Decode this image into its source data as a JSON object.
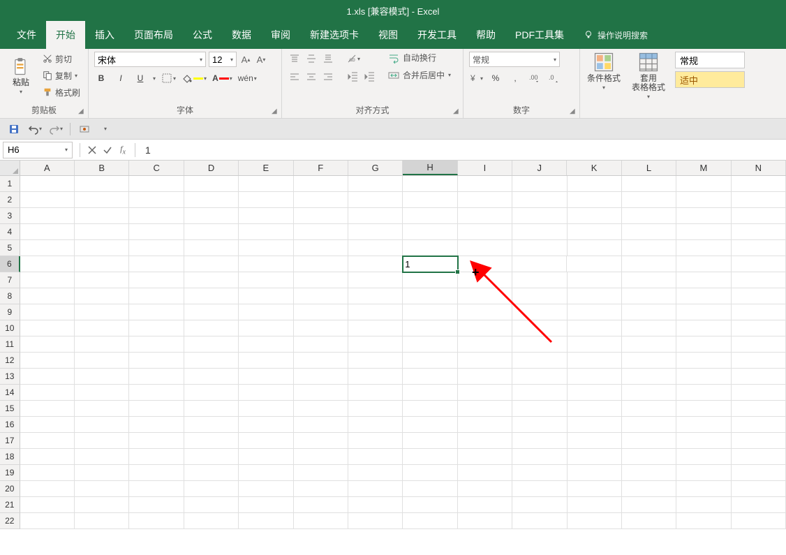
{
  "title": "1.xls  [兼容模式]  -  Excel",
  "tabs": [
    "文件",
    "开始",
    "插入",
    "页面布局",
    "公式",
    "数据",
    "审阅",
    "新建选项卡",
    "视图",
    "开发工具",
    "帮助",
    "PDF工具集"
  ],
  "active_tab_index": 1,
  "tell_me": "操作说明搜索",
  "ribbon": {
    "clipboard": {
      "paste": "粘贴",
      "cut": "剪切",
      "copy": "复制",
      "format_painter": "格式刷",
      "label": "剪贴板"
    },
    "font": {
      "name": "宋体",
      "size": "12",
      "label": "字体"
    },
    "alignment": {
      "wrap": "自动换行",
      "merge": "合并后居中",
      "label": "对齐方式"
    },
    "number": {
      "format": "常规",
      "label": "数字"
    },
    "styles": {
      "cond": "条件格式",
      "table": "套用\n表格格式",
      "normal": "常规",
      "neutral": "适中"
    }
  },
  "formula_bar": {
    "namebox": "H6",
    "value": "1"
  },
  "grid": {
    "columns": [
      "A",
      "B",
      "C",
      "D",
      "E",
      "F",
      "G",
      "H",
      "I",
      "J",
      "K",
      "L",
      "M",
      "N"
    ],
    "rows": 22,
    "selected_col": "H",
    "selected_row": 6,
    "cell_value": "1"
  }
}
